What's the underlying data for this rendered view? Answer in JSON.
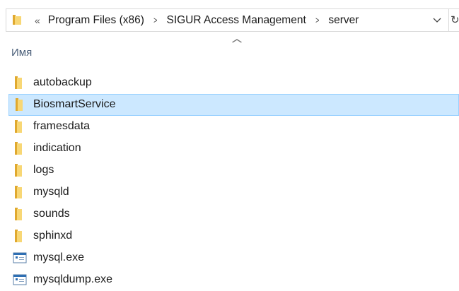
{
  "address": {
    "overflow_label": "«",
    "crumbs": [
      "Program Files (x86)",
      "SIGUR Access Management",
      "server"
    ],
    "dropdown_icon": "chevron-down-icon",
    "refresh_icon": "refresh-icon"
  },
  "column": {
    "name_header": "Имя",
    "sort_indicator": "sort-ascending-icon"
  },
  "files": [
    {
      "name": "autobackup",
      "type": "folder"
    },
    {
      "name": "BiosmartService",
      "type": "folder",
      "selected": true
    },
    {
      "name": "framesdata",
      "type": "folder"
    },
    {
      "name": "indication",
      "type": "folder"
    },
    {
      "name": "logs",
      "type": "folder"
    },
    {
      "name": "mysqld",
      "type": "folder"
    },
    {
      "name": "sounds",
      "type": "folder"
    },
    {
      "name": "sphinxd",
      "type": "folder"
    },
    {
      "name": "mysql.exe",
      "type": "exe"
    },
    {
      "name": "mysqldump.exe",
      "type": "exe"
    }
  ],
  "colors": {
    "selection_bg": "#cce8ff",
    "selection_border": "#99d1ff",
    "folder": "#f8d775",
    "header_text": "#4c607a"
  }
}
